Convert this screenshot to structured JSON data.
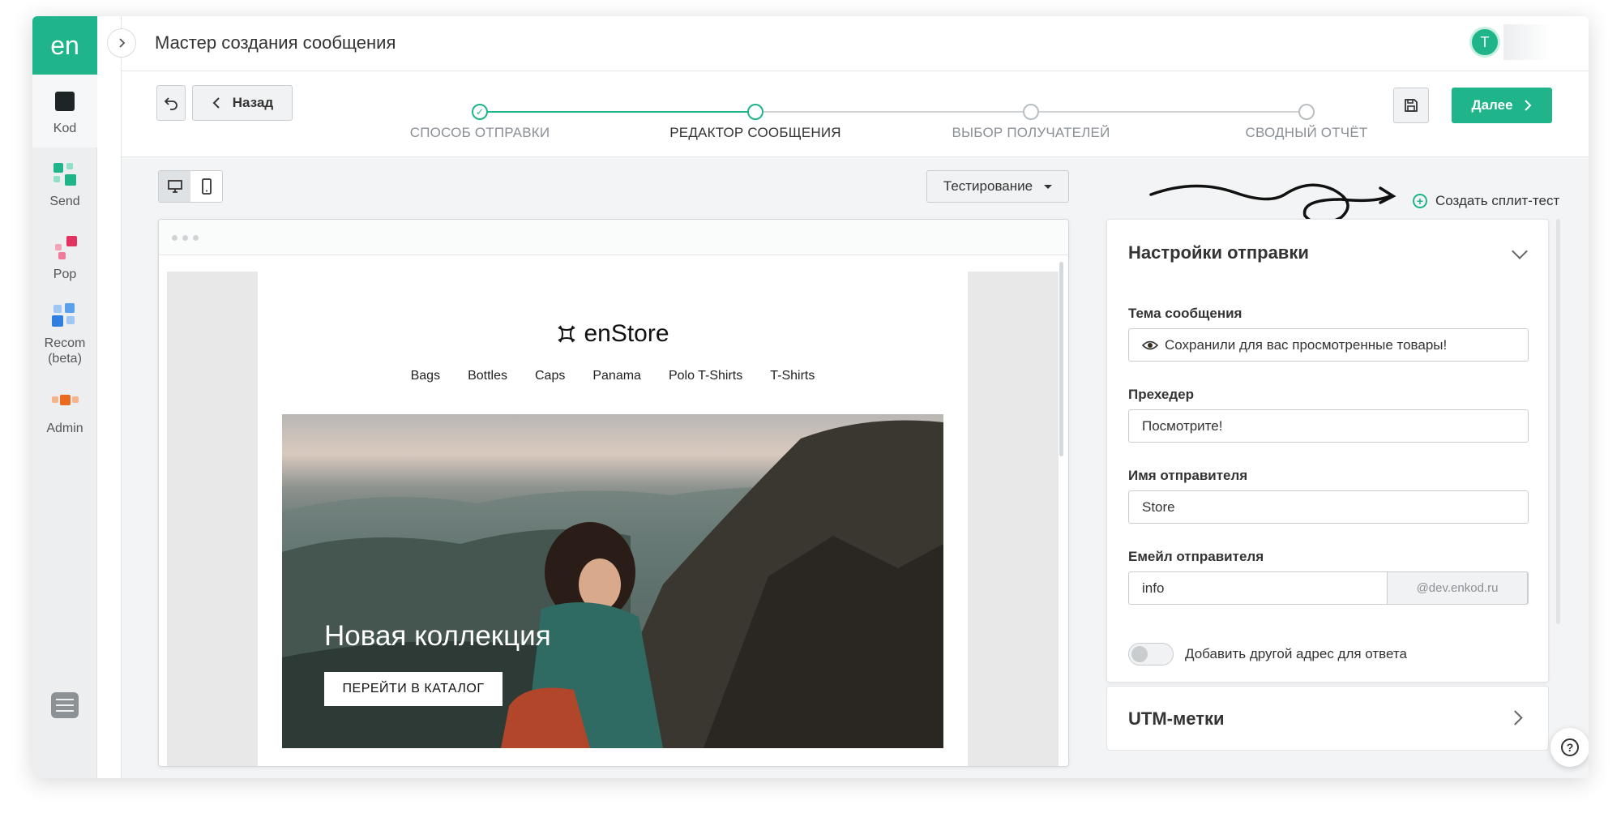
{
  "sidebar": {
    "logo": "en",
    "items": [
      {
        "label": "Kod",
        "icon": "kod-square-icon"
      },
      {
        "label": "Send",
        "icon": "send-blocks-icon"
      },
      {
        "label": "Pop",
        "icon": "pop-blocks-icon"
      },
      {
        "label": "Recom (beta)",
        "icon": "recom-blocks-icon"
      },
      {
        "label": "Admin",
        "icon": "admin-blocks-icon"
      }
    ]
  },
  "header": {
    "title": "Мастер создания сообщения",
    "avatar_initial": "T"
  },
  "wizard": {
    "back_label": "Назад",
    "next_label": "Далее",
    "steps": [
      {
        "label": "СПОСОБ ОТПРАВКИ",
        "state": "done"
      },
      {
        "label": "РЕДАКТОР СООБЩЕНИЯ",
        "state": "current"
      },
      {
        "label": "ВЫБОР ПОЛУЧАТЕЛЕЙ",
        "state": "pending"
      },
      {
        "label": "СВОДНЫЙ ОТЧЁТ",
        "state": "pending"
      }
    ]
  },
  "editor": {
    "testing_label": "Тестирование",
    "split_test_label": "Создать сплит-тест"
  },
  "email": {
    "brand": "enStore",
    "menu": [
      "Bags",
      "Bottles",
      "Caps",
      "Panama",
      "Polo T-Shirts",
      "T-Shirts"
    ],
    "hero_title": "Новая коллекция",
    "hero_button": "ПЕРЕЙТИ В КАТАЛОГ"
  },
  "settings": {
    "title": "Настройки отправки",
    "subject_label": "Тема сообщения",
    "subject_value": "Сохранили для вас просмотренные товары!",
    "preheader_label": "Прехедер",
    "preheader_value": "Посмотрите!",
    "sender_name_label": "Имя отправителя",
    "sender_name_value": "Store",
    "sender_email_label": "Емейл отправителя",
    "sender_email_value": "info",
    "sender_email_domain": "@dev.enkod.ru",
    "reply_toggle_label": "Добавить другой адрес для ответа"
  },
  "utm": {
    "title": "UTM-метки"
  },
  "colors": {
    "accent": "#1fb48a",
    "sidebar_bg": "#eceeef",
    "page_bg": "#f3f4f5"
  }
}
